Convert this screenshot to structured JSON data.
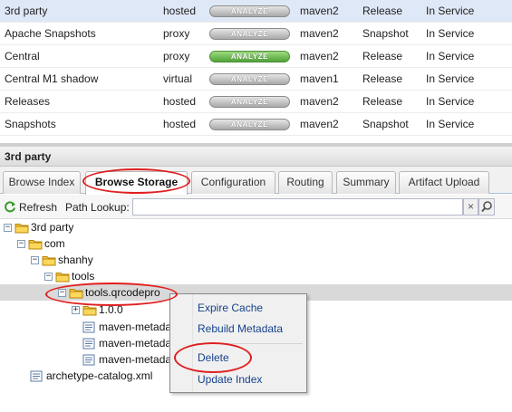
{
  "repositories": [
    {
      "name": "3rd party",
      "type": "hosted",
      "analyze": "ANALYZE",
      "analyze_color": "#a9a9a9",
      "format": "maven2",
      "policy": "Release",
      "status": "In Service"
    },
    {
      "name": "Apache Snapshots",
      "type": "proxy",
      "analyze": "ANALYZE",
      "analyze_color": "#a9a9a9",
      "format": "maven2",
      "policy": "Snapshot",
      "status": "In Service"
    },
    {
      "name": "Central",
      "type": "proxy",
      "analyze": "ANALYZE",
      "analyze_color": "#4fa338",
      "format": "maven2",
      "policy": "Release",
      "status": "In Service"
    },
    {
      "name": "Central M1 shadow",
      "type": "virtual",
      "analyze": "ANALYZE",
      "analyze_color": "#a9a9a9",
      "format": "maven1",
      "policy": "Release",
      "status": "In Service"
    },
    {
      "name": "Releases",
      "type": "hosted",
      "analyze": "ANALYZE",
      "analyze_color": "#a9a9a9",
      "format": "maven2",
      "policy": "Release",
      "status": "In Service"
    },
    {
      "name": "Snapshots",
      "type": "hosted",
      "analyze": "ANALYZE",
      "analyze_color": "#a9a9a9",
      "format": "maven2",
      "policy": "Snapshot",
      "status": "In Service"
    }
  ],
  "panel": {
    "title": "3rd party",
    "tabs": [
      {
        "label": "Browse Index",
        "active": false
      },
      {
        "label": "Browse Storage",
        "active": true
      },
      {
        "label": "Configuration",
        "active": false
      },
      {
        "label": "Routing",
        "active": false
      },
      {
        "label": "Summary",
        "active": false
      },
      {
        "label": "Artifact Upload",
        "active": false
      }
    ]
  },
  "toolbar": {
    "refresh_label": "Refresh",
    "path_lookup_label": "Path Lookup:",
    "path_value": "",
    "clear_glyph": "×"
  },
  "tree": [
    {
      "label": "3rd party",
      "icon": "folder-icon",
      "expander": "⊟"
    },
    {
      "label": "com",
      "icon": "folder-icon",
      "expander": "⊟"
    },
    {
      "label": "shanhy",
      "icon": "folder-icon",
      "expander": "⊟"
    },
    {
      "label": "tools",
      "icon": "folder-icon",
      "expander": "⊟"
    },
    {
      "label": "tools.qrcodepro",
      "icon": "folder-icon",
      "expander": "⊟",
      "selected": true
    },
    {
      "label": "1.0.0",
      "icon": "folder-icon",
      "expander": "⊞"
    },
    {
      "label": "maven-metadata.xml",
      "icon": "file-icon"
    },
    {
      "label": "maven-metadata.xml.md5",
      "icon": "file-icon"
    },
    {
      "label": "maven-metadata.xml.sha1",
      "icon": "file-icon"
    },
    {
      "label": "archetype-catalog.xml",
      "icon": "file-icon"
    }
  ],
  "context_menu": {
    "items": [
      "Expire Cache",
      "Rebuild Metadata",
      "Delete",
      "Update Index"
    ]
  },
  "colors": {
    "selection": "#dfe8f6",
    "menu_text": "#15428b",
    "annotation": "#e02020",
    "folder": "#f5c842"
  }
}
